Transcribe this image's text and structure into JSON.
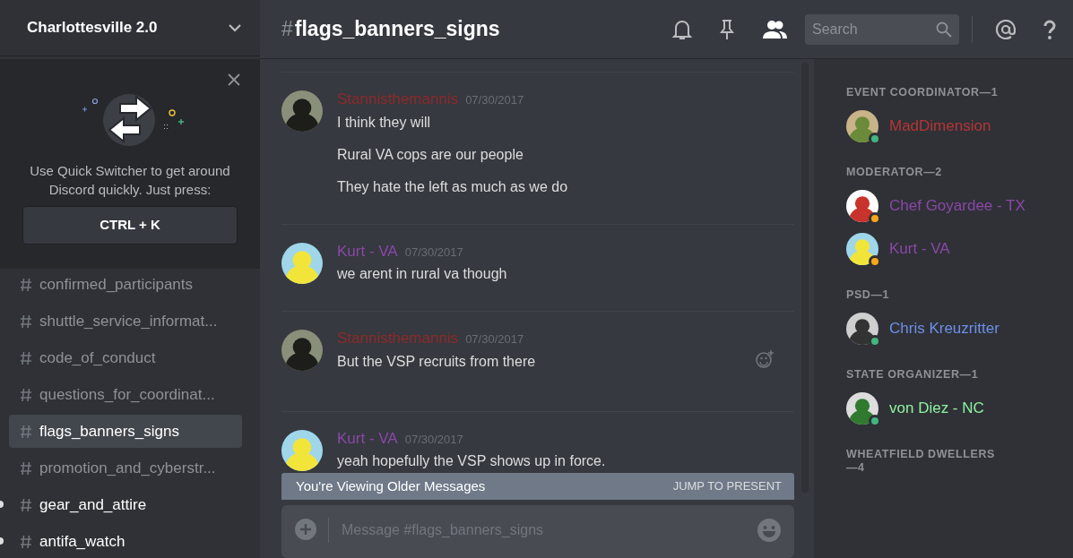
{
  "server": {
    "name": "Charlottesville 2.0"
  },
  "quick_switcher": {
    "text": "Use Quick Switcher to get around Discord quickly. Just press:",
    "shortcut": "CTRL + K"
  },
  "channels": [
    {
      "name": "confirmed_participants",
      "selected": false,
      "unread": false
    },
    {
      "name": "shuttle_service_informat...",
      "selected": false,
      "unread": false
    },
    {
      "name": "code_of_conduct",
      "selected": false,
      "unread": false
    },
    {
      "name": "questions_for_coordinat...",
      "selected": false,
      "unread": false
    },
    {
      "name": "flags_banners_signs",
      "selected": true,
      "unread": false
    },
    {
      "name": "promotion_and_cyberstr...",
      "selected": false,
      "unread": false
    },
    {
      "name": "gear_and_attire",
      "selected": false,
      "unread": true
    },
    {
      "name": "antifa_watch",
      "selected": false,
      "unread": true
    }
  ],
  "channel_header": {
    "hash": "#",
    "name": "flags_banners_signs",
    "members_shown": true,
    "search_placeholder": "Search"
  },
  "messages": [
    {
      "author": "Stannisthemannis",
      "color": "#8c2a2a",
      "date": "07/30/2017",
      "lines": [
        "I think they will",
        "Rural VA cops are our people",
        "They hate the left as much as we do"
      ],
      "reaction_button": false
    },
    {
      "author": "Kurt - VA",
      "color": "#8a48a8",
      "date": "07/30/2017",
      "lines": [
        "we arent in rural va though"
      ],
      "reaction_button": false
    },
    {
      "author": "Stannisthemannis",
      "color": "#8c2a2a",
      "date": "07/30/2017",
      "lines": [
        "But the VSP recruits from there"
      ],
      "reaction_button": true
    },
    {
      "author": "Kurt - VA",
      "color": "#8a48a8",
      "date": "07/30/2017",
      "lines": [
        "yeah hopefully the VSP shows up in force."
      ],
      "reaction_button": false
    }
  ],
  "older_banner": {
    "text": "You're Viewing Older Messages",
    "action": "JUMP TO PRESENT"
  },
  "composer": {
    "placeholder": "Message #flags_banners_signs"
  },
  "member_groups": [
    {
      "title": "EVENT COORDINATOR—1",
      "members": [
        {
          "name": "MadDimension",
          "color": "#b53535",
          "idle": false
        }
      ]
    },
    {
      "title": "MODERATOR—2",
      "members": [
        {
          "name": "Chef Goyardee - TX",
          "color": "#8a48a8",
          "idle": true
        },
        {
          "name": "Kurt - VA",
          "color": "#8a48a8",
          "idle": true
        }
      ]
    },
    {
      "title": "PSD—1",
      "members": [
        {
          "name": "Chris Kreuzritter",
          "color": "#6d8fe8",
          "idle": false
        }
      ]
    },
    {
      "title": "STATE ORGANIZER—1",
      "members": [
        {
          "name": "von Diez - NC",
          "color": "#8ef0a0",
          "idle": false
        }
      ]
    },
    {
      "title": "WHEATFIELD DWELLERS—4"
    }
  ]
}
